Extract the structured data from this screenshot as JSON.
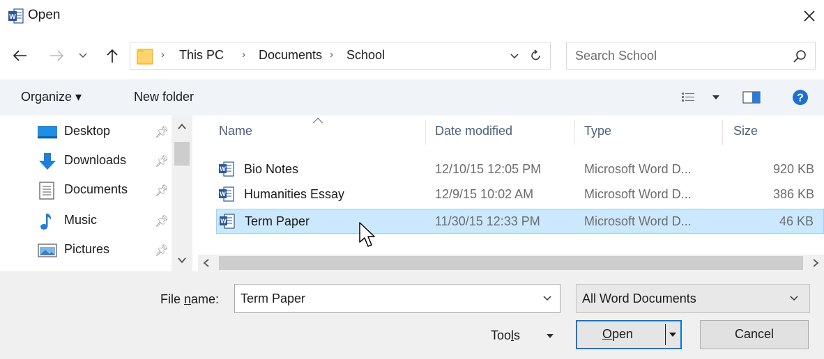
{
  "window": {
    "title": "Open",
    "app_icon": "word-icon",
    "close_icon": "close-icon"
  },
  "address": {
    "breadcrumbs": [
      "This PC",
      "Documents",
      "School"
    ],
    "separator": "›",
    "search_placeholder": "Search School"
  },
  "commandbar": {
    "organize_label": "Organize ▾",
    "new_folder_label": "New folder"
  },
  "navpane": {
    "items": [
      {
        "label": "Desktop",
        "icon": "desktop-icon"
      },
      {
        "label": "Downloads",
        "icon": "downloads-icon"
      },
      {
        "label": "Documents",
        "icon": "documents-icon"
      },
      {
        "label": "Music",
        "icon": "music-icon"
      },
      {
        "label": "Pictures",
        "icon": "pictures-icon"
      }
    ]
  },
  "filelist": {
    "columns": [
      "Name",
      "Date modified",
      "Type",
      "Size"
    ],
    "rows": [
      {
        "name": "Bio Notes",
        "date": "12/10/15 12:05 PM",
        "type": "Microsoft Word D...",
        "size": "920 KB"
      },
      {
        "name": "Humanities Essay",
        "date": "12/9/15 10:02 AM",
        "type": "Microsoft Word D...",
        "size": "386 KB"
      },
      {
        "name": "Term Paper",
        "date": "11/30/15 12:33 PM",
        "type": "Microsoft Word D...",
        "size": "46 KB"
      }
    ],
    "selected_row": "Term Paper"
  },
  "bottom": {
    "filename_label_pre": "File ",
    "filename_label_u": "n",
    "filename_label_post": "ame:",
    "filename_value": "Term Paper",
    "filetype_value": "All Word Documents",
    "tools_label_pre": "Too",
    "tools_label_u": "l",
    "tools_label_post": "s",
    "open_label_u": "O",
    "open_label_post": "pen",
    "cancel_label": "Cancel"
  },
  "colors": {
    "accent": "#0078d7",
    "selection": "#cce8ff",
    "commandbar": "#f0f4f9",
    "panel": "#f0f0f0"
  }
}
